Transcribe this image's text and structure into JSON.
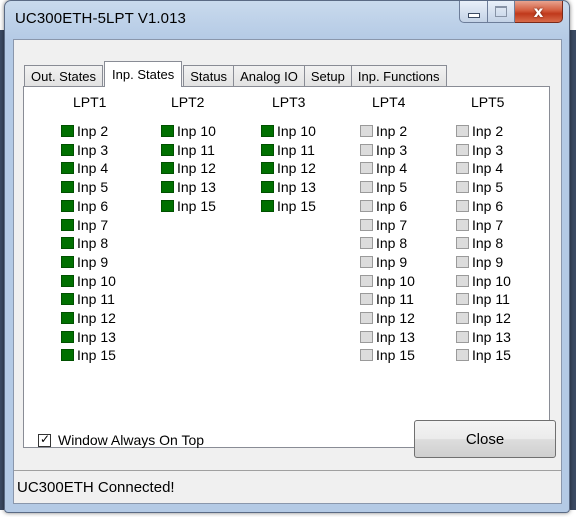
{
  "window": {
    "title": "UC300ETH-5LPT V1.013"
  },
  "caption_buttons": {
    "minimize_icon": "minimize-icon",
    "maximize_icon": "maximize-icon",
    "close_glyph": "x"
  },
  "tabs": [
    {
      "label": "Out. States",
      "active": false
    },
    {
      "label": "Inp. States",
      "active": true
    },
    {
      "label": "Status",
      "active": false
    },
    {
      "label": "Analog IO",
      "active": false
    },
    {
      "label": "Setup",
      "active": false
    },
    {
      "label": "Inp. Functions",
      "active": false
    }
  ],
  "colors": {
    "led_on": "#007000",
    "led_off": "#dcdcdc"
  },
  "ports": [
    {
      "name": "LPT1",
      "inputs": [
        {
          "label": "Inp 2",
          "on": true
        },
        {
          "label": "Inp 3",
          "on": true
        },
        {
          "label": "Inp 4",
          "on": true
        },
        {
          "label": "Inp 5",
          "on": true
        },
        {
          "label": "Inp 6",
          "on": true
        },
        {
          "label": "Inp 7",
          "on": true
        },
        {
          "label": "Inp 8",
          "on": true
        },
        {
          "label": "Inp 9",
          "on": true
        },
        {
          "label": "Inp 10",
          "on": true
        },
        {
          "label": "Inp 11",
          "on": true
        },
        {
          "label": "Inp 12",
          "on": true
        },
        {
          "label": "Inp 13",
          "on": true
        },
        {
          "label": "Inp 15",
          "on": true
        }
      ]
    },
    {
      "name": "LPT2",
      "inputs": [
        {
          "label": "Inp 10",
          "on": true
        },
        {
          "label": "Inp 11",
          "on": true
        },
        {
          "label": "Inp 12",
          "on": true
        },
        {
          "label": "Inp 13",
          "on": true
        },
        {
          "label": "Inp 15",
          "on": true
        }
      ]
    },
    {
      "name": "LPT3",
      "inputs": [
        {
          "label": "Inp 10",
          "on": true
        },
        {
          "label": "Inp 11",
          "on": true
        },
        {
          "label": "Inp 12",
          "on": true
        },
        {
          "label": "Inp 13",
          "on": true
        },
        {
          "label": "Inp 15",
          "on": true
        }
      ]
    },
    {
      "name": "LPT4",
      "inputs": [
        {
          "label": "Inp 2",
          "on": false
        },
        {
          "label": "Inp 3",
          "on": false
        },
        {
          "label": "Inp 4",
          "on": false
        },
        {
          "label": "Inp 5",
          "on": false
        },
        {
          "label": "Inp 6",
          "on": false
        },
        {
          "label": "Inp 7",
          "on": false
        },
        {
          "label": "Inp 8",
          "on": false
        },
        {
          "label": "Inp 9",
          "on": false
        },
        {
          "label": "Inp 10",
          "on": false
        },
        {
          "label": "Inp 11",
          "on": false
        },
        {
          "label": "Inp 12",
          "on": false
        },
        {
          "label": "Inp 13",
          "on": false
        },
        {
          "label": "Inp 15",
          "on": false
        }
      ]
    },
    {
      "name": "LPT5",
      "inputs": [
        {
          "label": "Inp 2",
          "on": false
        },
        {
          "label": "Inp 3",
          "on": false
        },
        {
          "label": "Inp 4",
          "on": false
        },
        {
          "label": "Inp 5",
          "on": false
        },
        {
          "label": "Inp 6",
          "on": false
        },
        {
          "label": "Inp 7",
          "on": false
        },
        {
          "label": "Inp 8",
          "on": false
        },
        {
          "label": "Inp 9",
          "on": false
        },
        {
          "label": "Inp 10",
          "on": false
        },
        {
          "label": "Inp 11",
          "on": false
        },
        {
          "label": "Inp 12",
          "on": false
        },
        {
          "label": "Inp 13",
          "on": false
        },
        {
          "label": "Inp 15",
          "on": false
        }
      ]
    }
  ],
  "always_on_top": {
    "label": "Window Always On Top",
    "checked": true,
    "check_glyph": "✓"
  },
  "close_button": {
    "label": "Close"
  },
  "status": {
    "text": "UC300ETH Connected!"
  }
}
